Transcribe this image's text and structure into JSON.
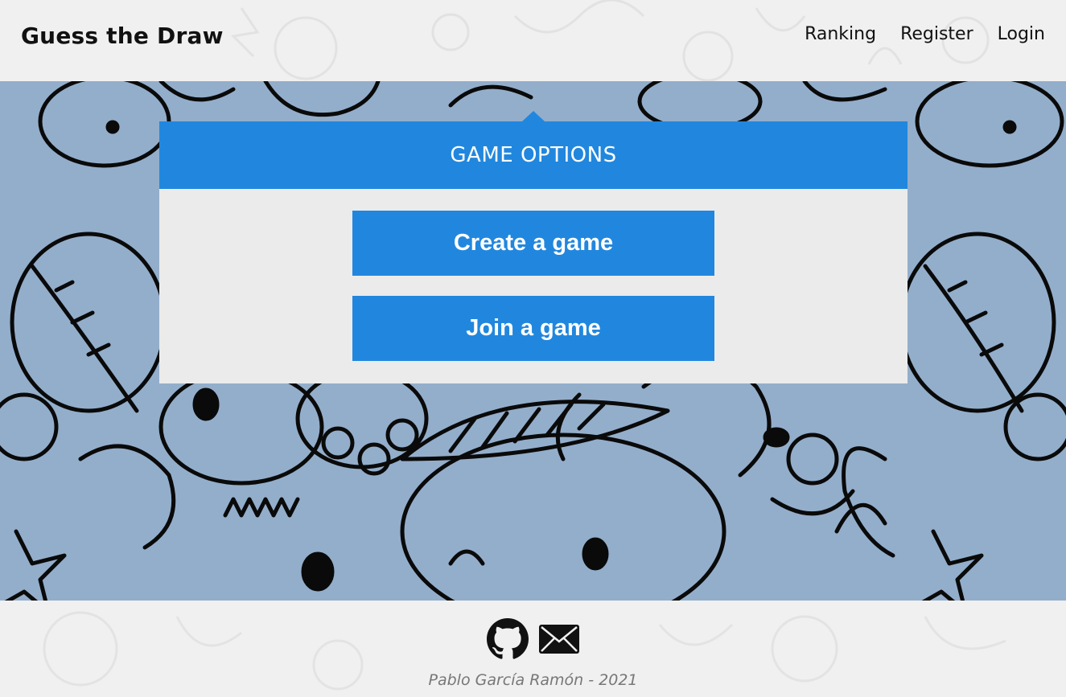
{
  "header": {
    "brand": "Guess the Draw",
    "nav": [
      {
        "label": "Ranking"
      },
      {
        "label": "Register"
      },
      {
        "label": "Login"
      }
    ]
  },
  "panel": {
    "title": "GAME OPTIONS",
    "create_label": "Create a game",
    "join_label": "Join a game"
  },
  "footer": {
    "icons": [
      "github-icon",
      "mail-icon"
    ],
    "credit": "Pablo García Ramón - 2021"
  },
  "colors": {
    "accent": "#2187de",
    "doodle_bg": "#93aecb",
    "panel_bg": "#ebebeb",
    "page_bg": "#f0f0f0"
  }
}
